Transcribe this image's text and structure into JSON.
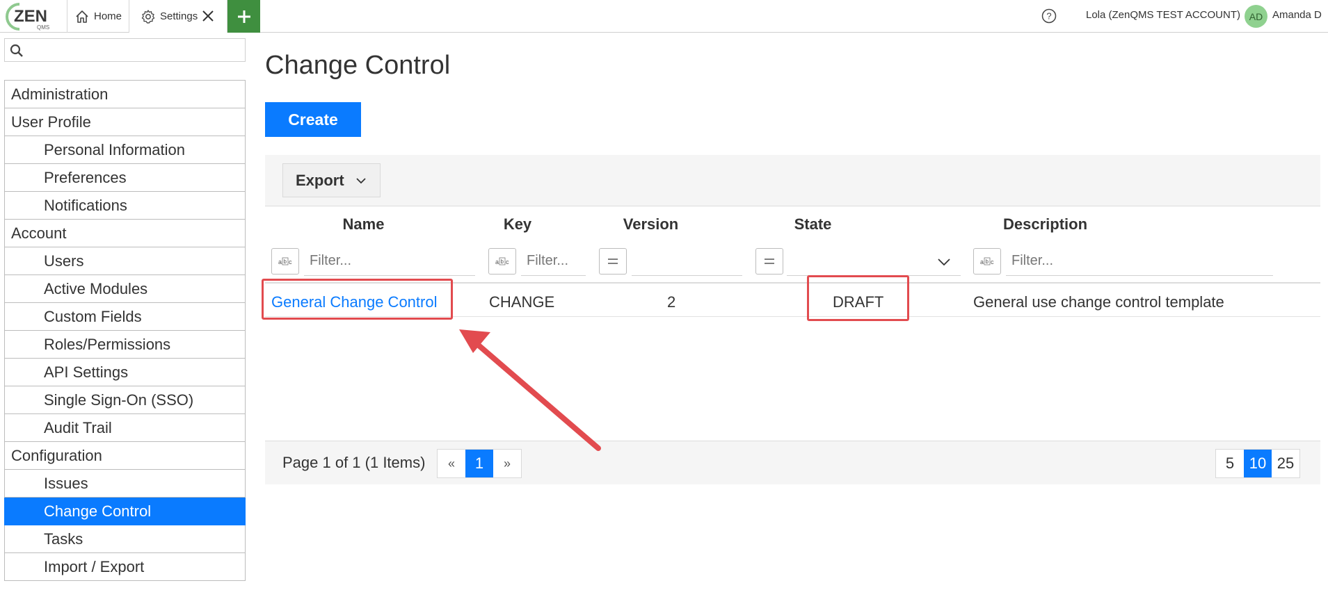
{
  "topbar": {
    "logo_text": "ZEN",
    "logo_sub": "QMS",
    "tabs": [
      {
        "label": "Home",
        "icon": "home-icon"
      },
      {
        "label": "Settings",
        "icon": "gear-icon"
      }
    ],
    "add_tab_label": "+",
    "account_label": "Lola (ZenQMS TEST ACCOUNT)",
    "avatar_initials": "AD",
    "user_name": "Amanda D"
  },
  "sidebar": {
    "search_placeholder": "",
    "items": [
      {
        "label": "Administration",
        "type": "section"
      },
      {
        "label": "User Profile",
        "type": "section"
      },
      {
        "label": "Personal Information",
        "type": "sub"
      },
      {
        "label": "Preferences",
        "type": "sub"
      },
      {
        "label": "Notifications",
        "type": "sub"
      },
      {
        "label": "Account",
        "type": "section"
      },
      {
        "label": "Users",
        "type": "sub"
      },
      {
        "label": "Active Modules",
        "type": "sub"
      },
      {
        "label": "Custom Fields",
        "type": "sub"
      },
      {
        "label": "Roles/Permissions",
        "type": "sub"
      },
      {
        "label": "API Settings",
        "type": "sub"
      },
      {
        "label": "Single Sign-On (SSO)",
        "type": "sub"
      },
      {
        "label": "Audit Trail",
        "type": "sub"
      },
      {
        "label": "Configuration",
        "type": "section"
      },
      {
        "label": "Issues",
        "type": "sub"
      },
      {
        "label": "Change Control",
        "type": "sub",
        "active": true
      },
      {
        "label": "Tasks",
        "type": "sub"
      },
      {
        "label": "Import / Export",
        "type": "sub"
      }
    ]
  },
  "main": {
    "title": "Change Control",
    "create_label": "Create",
    "export_label": "Export",
    "columns": [
      "Name",
      "Key",
      "Version",
      "State",
      "Description"
    ],
    "filter_placeholder": "Filter...",
    "filter_button_abc": "abc",
    "filter_button_eq": "=",
    "rows": [
      {
        "name": "General Change Control",
        "key": "CHANGE",
        "version": "2",
        "state": "DRAFT",
        "description": "General use change control template"
      }
    ],
    "pager": {
      "info": "Page 1 of 1 (1 Items)",
      "prev": "«",
      "current": "1",
      "next": "»",
      "sizes": [
        "5",
        "10",
        "25"
      ],
      "active_size": "10"
    }
  },
  "colors": {
    "accent": "#0a7bff",
    "add_tab": "#3f8f3f",
    "annotation": "#e24b4f",
    "avatar": "#8fd18f"
  }
}
